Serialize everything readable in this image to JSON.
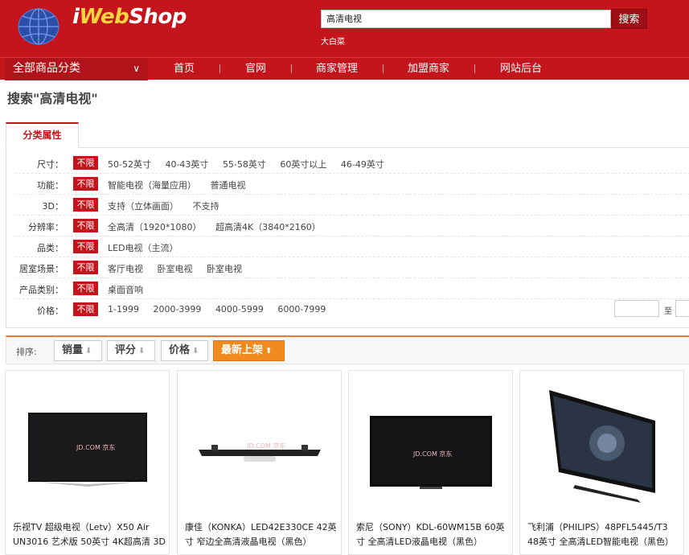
{
  "header": {
    "logo_i": "i",
    "logo_web": "Web",
    "logo_shop": "Shop",
    "search_value": "高清电视",
    "search_button": "搜索",
    "hot_word": "大白菜"
  },
  "nav": {
    "category_label": "全部商品分类",
    "items": [
      "首页",
      "官网",
      "商家管理",
      "加盟商家",
      "网站后台"
    ]
  },
  "search_title": "搜索\"高清电视\"",
  "filter": {
    "tab_label": "分类属性",
    "unlimited_label": "不限",
    "rows": [
      {
        "label": "尺寸：",
        "options": [
          "50-52英寸",
          "40-43英寸",
          "55-58英寸",
          "60英寸以上",
          "46-49英寸"
        ]
      },
      {
        "label": "功能：",
        "options": [
          "智能电视（海量应用）",
          "普通电视"
        ]
      },
      {
        "label": "3D：",
        "options": [
          "支持（立体画面）",
          "不支持"
        ]
      },
      {
        "label": "分辨率：",
        "options": [
          "全高清（1920*1080）",
          "超高清4K（3840*2160）"
        ]
      },
      {
        "label": "品类：",
        "options": [
          "LED电视（主流）"
        ]
      },
      {
        "label": "居室场景：",
        "options": [
          "客厅电视",
          "卧室电视",
          "卧室电视"
        ]
      },
      {
        "label": "产品类别：",
        "options": [
          "桌面音响"
        ]
      },
      {
        "label": "价格：",
        "options": [
          "1-1999",
          "2000-3999",
          "4000-5999",
          "6000-7999"
        ]
      }
    ],
    "price_to": "至"
  },
  "sort": {
    "label": "排序:",
    "buttons": [
      {
        "label": "销量",
        "arrow": "⬇"
      },
      {
        "label": "评分",
        "arrow": "⬇"
      },
      {
        "label": "价格",
        "arrow": "⬇"
      },
      {
        "label": "最新上架",
        "arrow": "⬆"
      }
    ]
  },
  "products": [
    {
      "name": "乐视TV 超级电视（Letv）X50 Air UN3016 艺术版 50英寸 4K超高清 3D",
      "watermark": "JD.COM 京东"
    },
    {
      "name": "康佳（KONKA）LED42E330CE 42英寸 窄边全高清液晶电视（黑色）",
      "watermark": "JD.COM 京东"
    },
    {
      "name": "索尼（SONY）KDL-60WM15B 60英寸 全高清LED液晶电视（黑色）",
      "watermark": "JD.COM 京东"
    },
    {
      "name": "飞利浦（PHILIPS）48PFL5445/T3 48英寸 全高清LED智能电视（黑色）",
      "watermark": ""
    }
  ],
  "colors": {
    "brand_red": "#c4151c",
    "accent_orange": "#f08a1f"
  }
}
